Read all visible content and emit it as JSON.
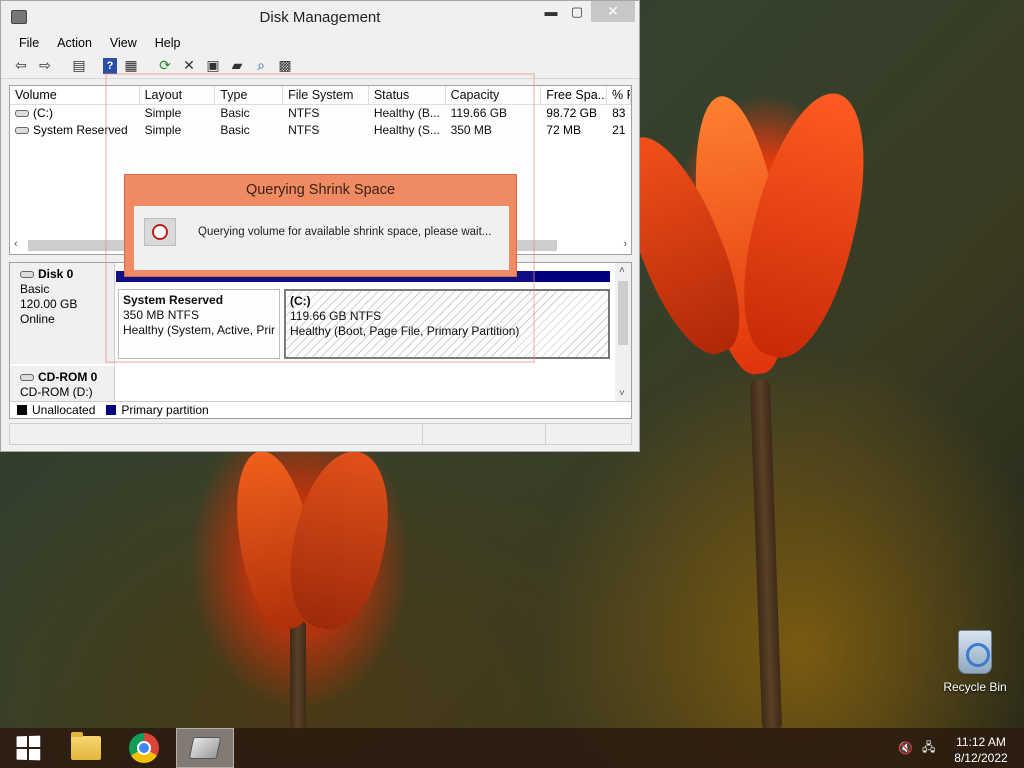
{
  "window": {
    "title": "Disk Management",
    "minimize": "▬",
    "maximize": "▢",
    "close": "✕"
  },
  "menu": [
    "File",
    "Action",
    "View",
    "Help"
  ],
  "toolbar_icons": [
    "back-icon",
    "forward-icon",
    "console-tree-icon",
    "help-icon",
    "properties-icon",
    "refresh-icon",
    "delete-icon",
    "settings-icon",
    "open-icon",
    "find-icon",
    "export-icon"
  ],
  "volume_list": {
    "columns": [
      "Volume",
      "Layout",
      "Type",
      "File System",
      "Status",
      "Capacity",
      "Free Spa...",
      "% F"
    ],
    "rows": [
      [
        "(C:)",
        "Simple",
        "Basic",
        "NTFS",
        "Healthy (B...",
        "119.66 GB",
        "98.72 GB",
        "83"
      ],
      [
        "System Reserved",
        "Simple",
        "Basic",
        "NTFS",
        "Healthy (S...",
        "350 MB",
        "72 MB",
        "21"
      ]
    ]
  },
  "disks": [
    {
      "name": "Disk 0",
      "type": "Basic",
      "size": "120.00 GB",
      "state": "Online",
      "partitions": [
        {
          "name": "System Reserved",
          "size": "350 MB NTFS",
          "status": "Healthy (System, Active, Prir"
        },
        {
          "name": "(C:)",
          "size": "119.66 GB NTFS",
          "status": "Healthy (Boot, Page File, Primary Partition)"
        }
      ]
    },
    {
      "name": "CD-ROM 0",
      "type": "CD-ROM (D:)"
    }
  ],
  "legend": [
    {
      "label": "Unallocated",
      "color": "#000000"
    },
    {
      "label": "Primary partition",
      "color": "#000080"
    }
  ],
  "dialog": {
    "title": "Querying Shrink Space",
    "message": "Querying volume for available shrink space, please wait...",
    "icon": "clock-icon",
    "accent": "#f08a63"
  },
  "desktop": {
    "recycle_bin": "Recycle Bin"
  },
  "taskbar": {
    "items": [
      "start-button",
      "file-explorer",
      "chrome",
      "disk-management"
    ],
    "time": "11:12 AM",
    "date": "8/12/2022"
  }
}
